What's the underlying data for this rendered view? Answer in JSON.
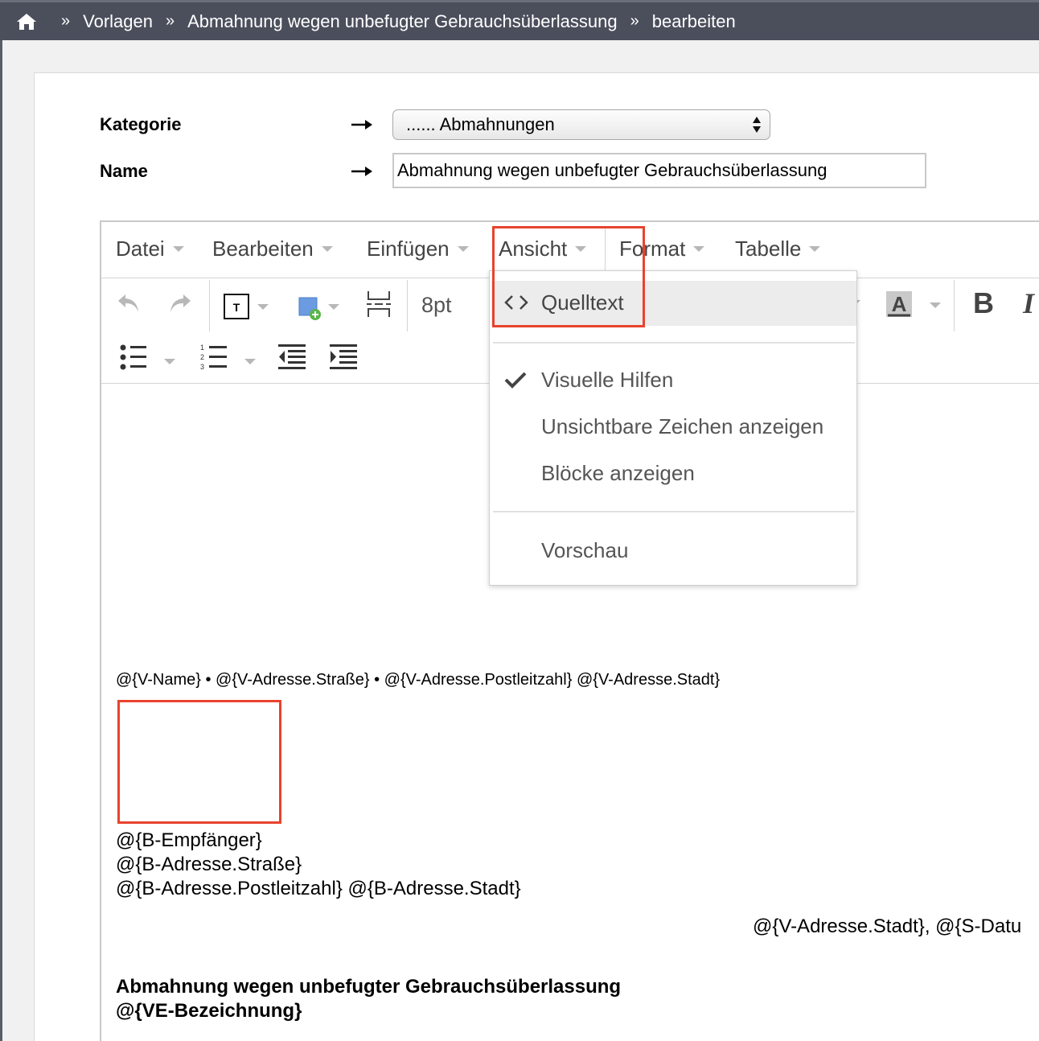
{
  "breadcrumb": {
    "home_icon": "home-icon",
    "separator": "»",
    "items": [
      "Vorlagen",
      "Abmahnung wegen unbefugter Gebrauchsüberlassung",
      "bearbeiten"
    ]
  },
  "form": {
    "kategorie_label": "Kategorie",
    "kategorie_value": "...... Abmahnungen",
    "name_label": "Name",
    "name_value": "Abmahnung wegen unbefugter Gebrauchsüberlassung"
  },
  "editor": {
    "menu": [
      "Datei",
      "Bearbeiten",
      "Einfügen",
      "Ansicht",
      "Format",
      "Tabelle"
    ],
    "font_size": "8pt",
    "bold_label": "B",
    "italic_label": "I",
    "text_color_label": "A"
  },
  "dropdown": {
    "source_label": "Quelltext",
    "visual_aids_label": "Visuelle Hilfen",
    "invisible_chars_label": "Unsichtbare Zeichen anzeigen",
    "show_blocks_label": "Blöcke anzeigen",
    "preview_label": "Vorschau"
  },
  "document": {
    "sender_line": "@{V-Name} • @{V-Adresse.Straße} • @{V-Adresse.Postleitzahl} @{V-Adresse.Stadt}",
    "recipient": [
      "@{B-Empfänger}",
      "@{B-Adresse.Straße}",
      "@{B-Adresse.Postleitzahl} @{B-Adresse.Stadt}"
    ],
    "date_line": "@{V-Adresse.Stadt}, @{S-Datu",
    "subject": [
      "Abmahnung wegen unbefugter Gebrauchsüberlassung",
      "@{VE-Bezeichnung}"
    ]
  },
  "colors": {
    "topbar": "#4b4f5c",
    "highlight": "#e8432e"
  }
}
